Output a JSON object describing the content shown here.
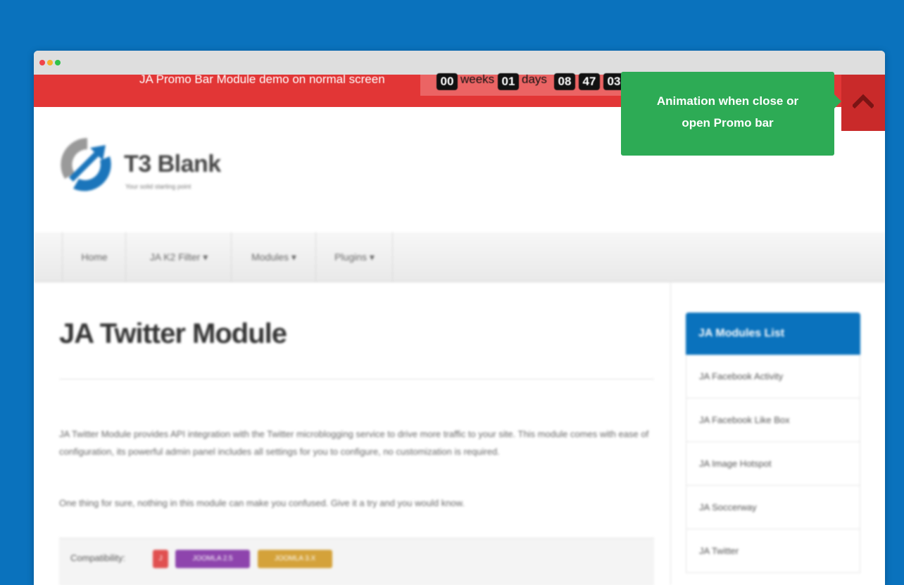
{
  "promo": {
    "text": "JA Promo Bar Module demo on normal screen",
    "countdown": {
      "weeks": "00",
      "weeks_label": "weeks",
      "days": "01",
      "days_label": "days",
      "hours": "08",
      "minutes": "47",
      "seconds": "03"
    }
  },
  "tooltip": {
    "line1": "Animation when close or",
    "line2": "open Promo bar"
  },
  "site": {
    "logo_title": "T3 Blank",
    "logo_tagline": "Your solid starting point",
    "nav": [
      {
        "label": "Home"
      },
      {
        "label": "JA K2 Filter ▾"
      },
      {
        "label": "Modules ▾"
      },
      {
        "label": "Plugins ▾"
      }
    ],
    "page_title": "JA Twitter Module",
    "para1": "JA Twitter Module provides API integration with the Twitter microblogging service to drive more traffic to your site. This module comes with ease of configuration, its powerful admin panel includes all settings for you to configure, no customization is required.",
    "para2": "One thing for sure, nothing in this module can make you confused. Give it a try and you would know.",
    "compat_label": "Compatibility:",
    "badges": [
      "J",
      "JOOMLA 2.5",
      "JOOMLA 3.X"
    ],
    "sidebar_title": "JA Modules List",
    "sidebar_items": [
      {
        "label": "JA Facebook Activity"
      },
      {
        "label": "JA Facebook Like Box"
      },
      {
        "label": "JA Image Hotspot"
      },
      {
        "label": "JA Soccerway"
      },
      {
        "label": "JA Twitter"
      }
    ]
  },
  "colors": {
    "background": "#0a72bd",
    "promo_bar": "#e23636",
    "tooltip": "#2dab55",
    "toggle": "#c92a2a"
  },
  "icons": {
    "toggle": "chevron-up-icon"
  }
}
